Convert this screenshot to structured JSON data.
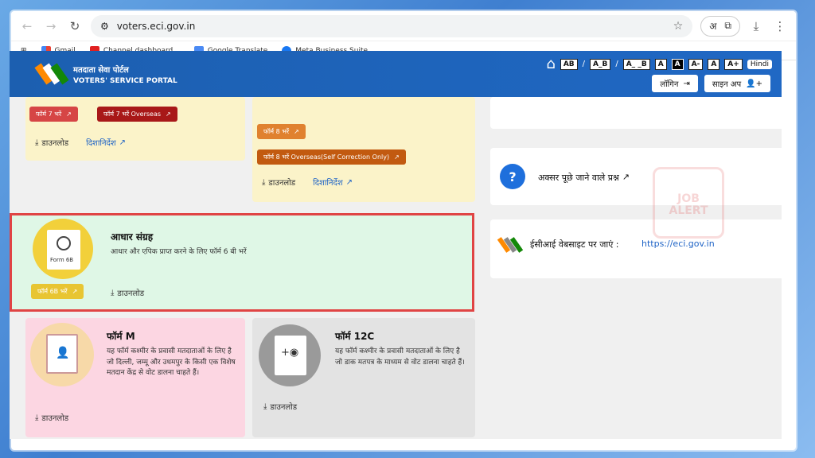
{
  "browser": {
    "url": "voters.eci.gov.in",
    "translate_label": "अ",
    "bookmarks": [
      "Gmail",
      "Channel dashboard...",
      "Google Translate",
      "Meta Business Suite"
    ]
  },
  "header": {
    "title_hindi": "मतदाता सेवा पोर्टल",
    "title_en": "VOTERS' SERVICE PORTAL",
    "font_sizes": [
      "AB",
      "A_B",
      "A_ _B"
    ],
    "contrast": [
      "A",
      "A"
    ],
    "text_size": [
      "A-",
      "A",
      "A+"
    ],
    "language": "Hindi",
    "login_label": "लॉगिन",
    "signup_label": "साइन अप"
  },
  "cards": {
    "form7": {
      "fill_btn": "फॉर्म 7 भरें",
      "overseas_btn": "फॉर्म 7 भरें Overseas",
      "download": "डाउनलोड",
      "guidelines": "दिशानिर्देश"
    },
    "form8": {
      "fill_btn": "फॉर्म 8 भरें",
      "overseas_btn": "फॉर्म 8 भरें Overseas(Self Correction Only)",
      "download": "डाउनलोड",
      "guidelines": "दिशानिर्देश"
    },
    "aadhar": {
      "title": "आधार संग्रह",
      "desc": "आधार और एपिक प्राप्त करने के लिए फॉर्म 6 बी भरें",
      "icon_label": "Form 6B",
      "fill_btn": "फॉर्म 6B भरें",
      "download": "डाउनलोड"
    },
    "formM": {
      "title": "फॉर्म M",
      "desc": "यह फॉर्म कश्मीर के प्रवासी मतदाताओं के लिए है जो दिल्ली, जम्मू और उधमपुर के किसी एक विशेष मतदान केंद्र से वोट डालना चाहते हैं।",
      "download": "डाउनलोड"
    },
    "form12c": {
      "title": "फॉर्म 12C",
      "desc": "यह फॉर्म कश्मीर के प्रवासी मतदाताओं के लिए है जो डाक मतपत्र के माध्यम से वोट डालना चाहते हैं।",
      "download": "डाउनलोड"
    }
  },
  "sidebar": {
    "faq": "अक्सर पूछे जाने वाले प्रश्न",
    "eci_prefix": "ईसीआई वेबसाइट पर जाएं :",
    "eci_link": "https://eci.gov.in"
  },
  "colors": {
    "header_blue": "#1c5fb0",
    "form7_red": "#d64545",
    "form7_dark": "#a81818",
    "form8_orange": "#e0812f",
    "form8_dark": "#c25a10",
    "aadhar_yellow": "#f2d03a",
    "highlight_red": "#e04444"
  }
}
